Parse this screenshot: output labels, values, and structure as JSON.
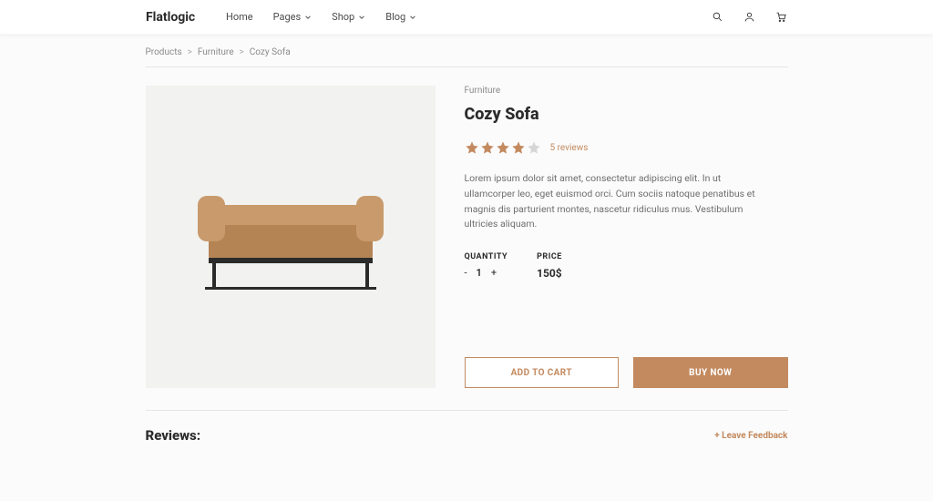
{
  "header": {
    "logo": "Flatlogic",
    "nav": {
      "home": "Home",
      "pages": "Pages",
      "shop": "Shop",
      "blog": "Blog"
    }
  },
  "breadcrumb": {
    "level1": "Products",
    "level2": "Furniture",
    "level3": "Cozy Sofa"
  },
  "product": {
    "category": "Furniture",
    "title": "Cozy Sofa",
    "rating": 4,
    "review_count_text": "5 reviews",
    "description": "Lorem ipsum dolor sit amet, consectetur adipiscing elit. In ut ullamcorper leo, eget euismod orci. Cum sociis natoque penatibus et magnis dis parturient montes, nascetur ridiculus mus. Vestibulum ultricies aliquam.",
    "quantity_label": "QUANTITY",
    "quantity": "1",
    "minus": "-",
    "plus": "+",
    "price_label": "PRICE",
    "price": "150$",
    "add_to_cart": "ADD TO CART",
    "buy_now": "BUY NOW"
  },
  "reviews": {
    "heading": "Reviews:",
    "leave_feedback": "+ Leave Feedback"
  }
}
